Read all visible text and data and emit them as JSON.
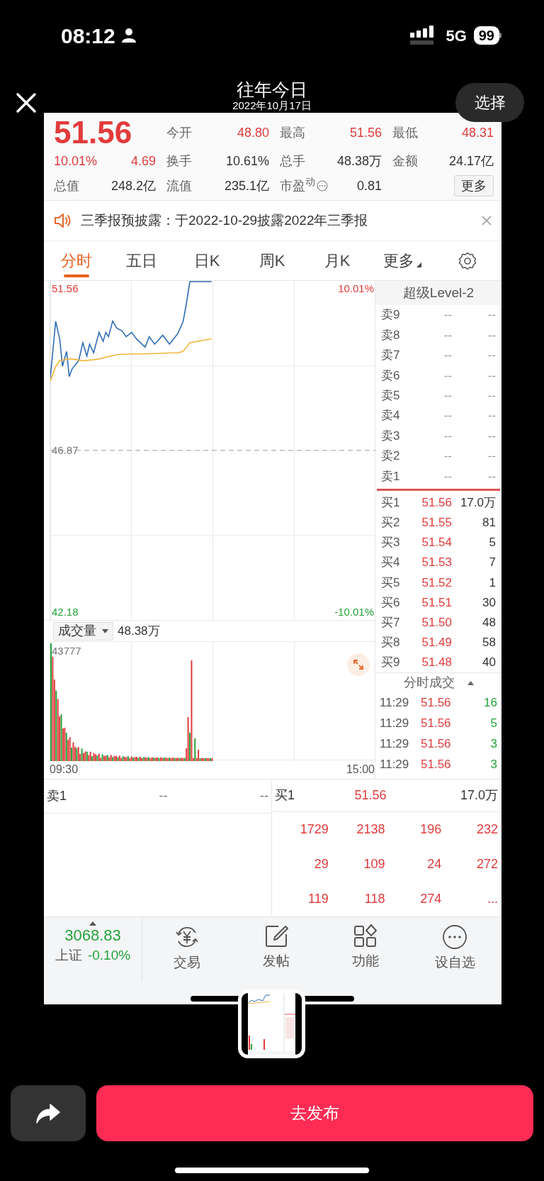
{
  "status_bar": {
    "time": "08:12",
    "network": "5G",
    "battery": "99"
  },
  "header": {
    "title": "往年今日",
    "date": "2022年10月17日",
    "select_button": "选择"
  },
  "quote": {
    "price": "51.56",
    "change_pct": "10.01%",
    "change": "4.69",
    "stats": [
      {
        "label": "今开",
        "value": "48.80",
        "kind": "up"
      },
      {
        "label": "最高",
        "value": "51.56",
        "kind": "up"
      },
      {
        "label": "最低",
        "value": "48.31",
        "kind": "up"
      },
      {
        "label": "换手",
        "value": "10.61%",
        "kind": "plain"
      },
      {
        "label": "总手",
        "value": "48.38万",
        "kind": "plain"
      },
      {
        "label": "金额",
        "value": "24.17亿",
        "kind": "plain"
      },
      {
        "label": "总值",
        "value": "248.2亿",
        "kind": "plain"
      },
      {
        "label": "流值",
        "value": "235.1亿",
        "kind": "plain"
      },
      {
        "label": "市盈$^{动}$",
        "value": "0.81",
        "kind": "pe"
      }
    ],
    "more_button": "更多"
  },
  "notice": {
    "text": "三季报预披露：于2022-10-29披露2022年三季报"
  },
  "tabs": [
    {
      "label": "分时",
      "selected": true,
      "kind": "tab"
    },
    {
      "label": "五日",
      "selected": false,
      "kind": "tab"
    },
    {
      "label": "日K",
      "selected": false,
      "kind": "tab"
    },
    {
      "label": "周K",
      "selected": false,
      "kind": "tab"
    },
    {
      "label": "月K",
      "selected": false,
      "kind": "tab"
    },
    {
      "label": "更多",
      "selected": false,
      "kind": "menu"
    }
  ],
  "price_chart": {
    "price_high": "51.56",
    "price_mid": "46.87",
    "price_low": "42.18",
    "pct_high": "10.01%",
    "pct_low": "-10.01%"
  },
  "volume": {
    "selector": "成交量",
    "total": "48.38万",
    "max_label": "43777",
    "time_start": "09:30",
    "time_end": "15:00"
  },
  "order_book": {
    "title": "超级Level-2",
    "asks": [
      {
        "label": "卖9",
        "price": "--",
        "volume": "--"
      },
      {
        "label": "卖8",
        "price": "--",
        "volume": "--"
      },
      {
        "label": "卖7",
        "price": "--",
        "volume": "--"
      },
      {
        "label": "卖6",
        "price": "--",
        "volume": "--"
      },
      {
        "label": "卖5",
        "price": "--",
        "volume": "--"
      },
      {
        "label": "卖4",
        "price": "--",
        "volume": "--"
      },
      {
        "label": "卖3",
        "price": "--",
        "volume": "--"
      },
      {
        "label": "卖2",
        "price": "--",
        "volume": "--"
      },
      {
        "label": "卖1",
        "price": "--",
        "volume": "--"
      }
    ],
    "bids": [
      {
        "label": "买1",
        "price": "51.56",
        "volume": "17.0万"
      },
      {
        "label": "买2",
        "price": "51.55",
        "volume": "81"
      },
      {
        "label": "买3",
        "price": "51.54",
        "volume": "5"
      },
      {
        "label": "买4",
        "price": "51.53",
        "volume": "7"
      },
      {
        "label": "买5",
        "price": "51.52",
        "volume": "1"
      },
      {
        "label": "买6",
        "price": "51.51",
        "volume": "30"
      },
      {
        "label": "买7",
        "price": "51.50",
        "volume": "48"
      },
      {
        "label": "买8",
        "price": "51.49",
        "volume": "58"
      },
      {
        "label": "买9",
        "price": "51.48",
        "volume": "40"
      }
    ],
    "trades_title": "分时成交",
    "trades": [
      {
        "time": "11:29",
        "price": "51.56",
        "volume": "16"
      },
      {
        "time": "11:29",
        "price": "51.56",
        "volume": "5"
      },
      {
        "time": "11:29",
        "price": "51.56",
        "volume": "3"
      },
      {
        "time": "11:29",
        "price": "51.56",
        "volume": "3"
      }
    ]
  },
  "bottom_quote": {
    "ask": {
      "label": "卖1",
      "price": "--",
      "volume": "--"
    },
    "bid": {
      "label": "买1",
      "price": "51.56",
      "volume": "17.0万"
    },
    "queue": [
      "1729",
      "2138",
      "196",
      "232",
      "29",
      "109",
      "24",
      "272",
      "119",
      "118",
      "274",
      "..."
    ]
  },
  "bottom_nav": {
    "index": {
      "value": "3068.83",
      "name": "上证",
      "change": "-0.10%"
    },
    "items": [
      {
        "label": "交易",
        "kind": "trade"
      },
      {
        "label": "发帖",
        "kind": "post"
      },
      {
        "label": "功能",
        "kind": "apps"
      },
      {
        "label": "设自选",
        "kind": "watch"
      }
    ]
  },
  "publish_button": "去发布"
}
